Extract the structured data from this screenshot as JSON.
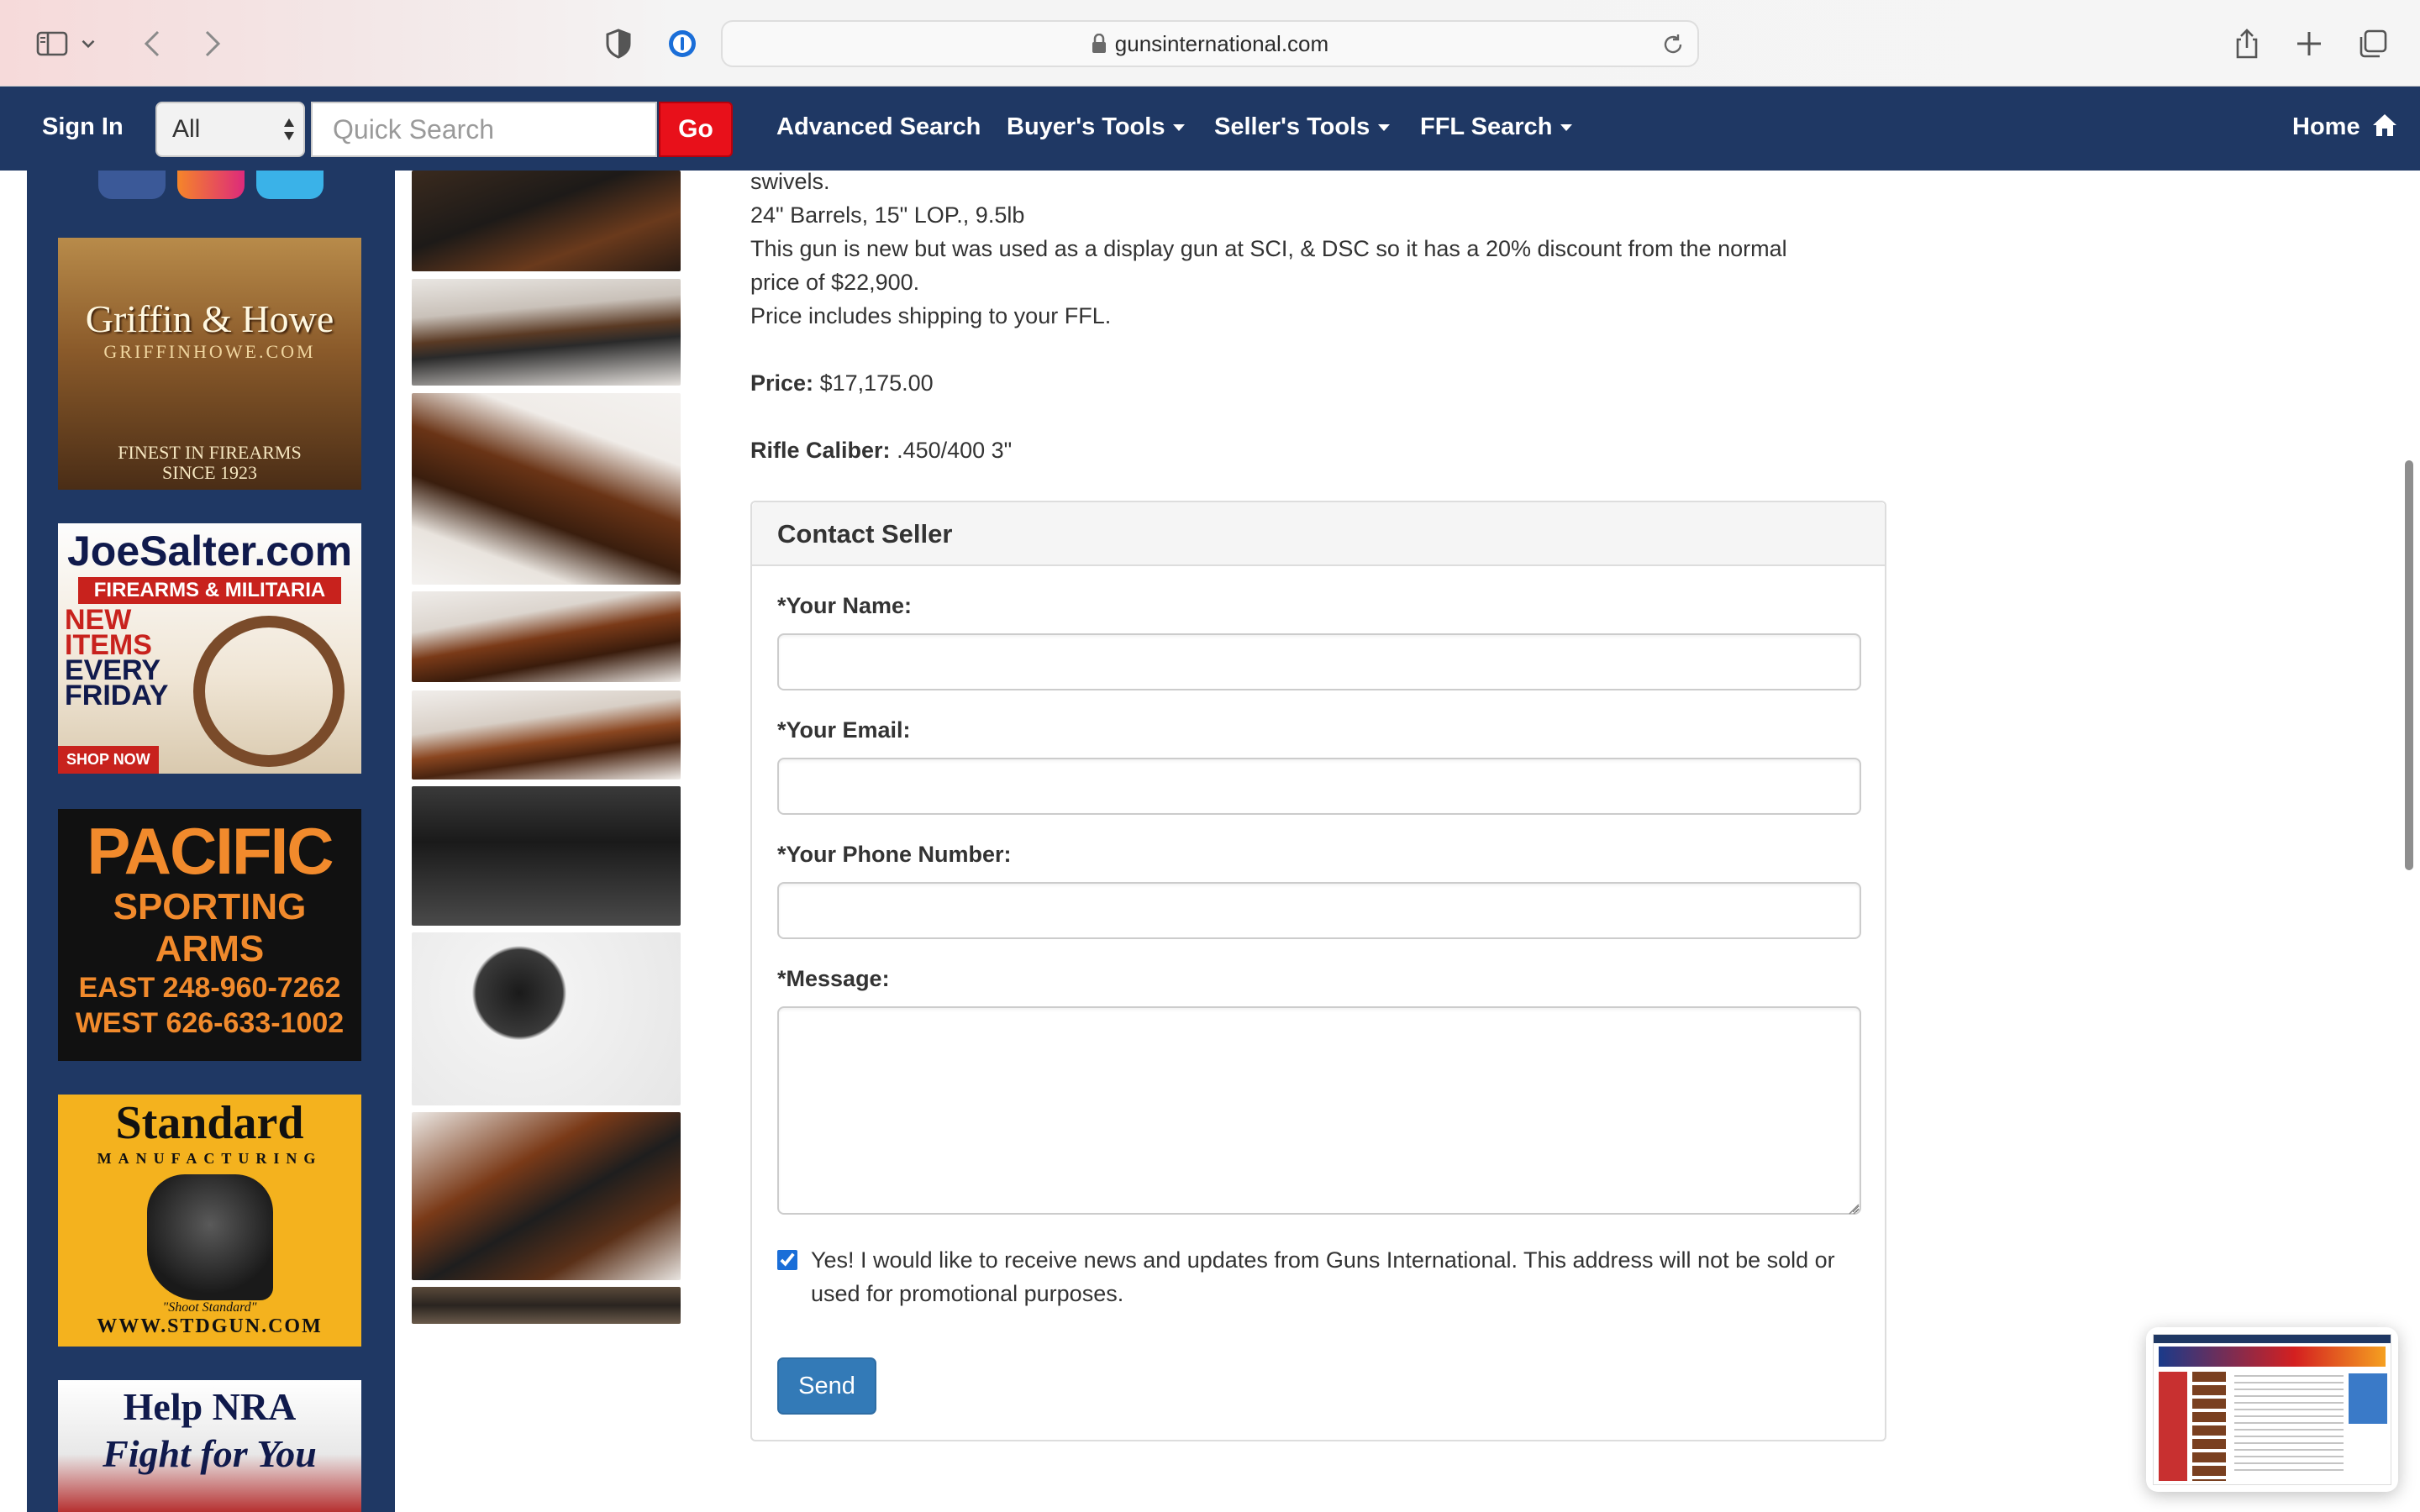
{
  "browser": {
    "url": "gunsinternational.com",
    "icons": [
      "sidebar-icon",
      "chevron-down-icon",
      "back-icon",
      "forward-icon",
      "privacy-shield-icon",
      "password-manager-icon",
      "lock-icon",
      "reload-icon",
      "share-icon",
      "new-tab-icon",
      "tabs-overview-icon"
    ]
  },
  "nav": {
    "sign_in": "Sign In",
    "search_category": "All",
    "search_placeholder": "Quick Search",
    "go": "Go",
    "advanced_search": "Advanced Search",
    "buyers_tools": "Buyer's Tools",
    "sellers_tools": "Seller's Tools",
    "ffl_search": "FFL Search",
    "home": "Home",
    "colors": {
      "bar": "#1f3864",
      "go": "#e8101a"
    }
  },
  "ads": {
    "griffin": {
      "title": "Griffin & Howe",
      "site": "GRIFFINHOWE.COM",
      "tagline1": "FINEST IN FIREARMS",
      "tagline2": "SINCE 1923"
    },
    "salter": {
      "title": "JoeSalter.com",
      "band": "FIREARMS & MILITARIA",
      "new1": "NEW",
      "new2": "ITEMS",
      "new3": "EVERY",
      "new4": "FRIDAY",
      "shop": "SHOP NOW"
    },
    "pacific": {
      "line1": "PACIFIC",
      "line2": "SPORTING ARMS",
      "east": "EAST   248-960-7262",
      "west": "WEST   626-633-1002"
    },
    "standard": {
      "title": "Standard",
      "sub": "MANUFACTURING",
      "tag": "\"Shoot Standard\"",
      "url": "WWW.STDGUN.COM"
    },
    "nra": {
      "line1": "Help NRA",
      "line2": "Fight for You"
    }
  },
  "listing": {
    "line_swivels": "swivels.",
    "line_specs": "24\" Barrels, 15\" LOP., 9.5lb",
    "line_display_1": "This gun is new but was used as a display gun at SCI, & DSC so it has a 20% discount from the normal",
    "line_display_2": "price of $22,900.",
    "line_shipping": "Price includes shipping to your FFL.",
    "price_label": "Price:",
    "price_value": "$17,175.00",
    "caliber_label": "Rifle Caliber:",
    "caliber_value": ".450/400 3\""
  },
  "contact": {
    "title": "Contact Seller",
    "name_label": "*Your Name:",
    "email_label": "*Your Email:",
    "phone_label": "*Your Phone Number:",
    "message_label": "*Message:",
    "name_value": "",
    "email_value": "",
    "phone_value": "",
    "message_value": "",
    "opt_in_checked": true,
    "opt_in_text": "Yes! I would like to receive news and updates from Guns International. This address will not be sold or used for promotional purposes.",
    "send": "Send",
    "colors": {
      "send": "#337ab7",
      "checkbox": "#1a6ed8"
    }
  }
}
